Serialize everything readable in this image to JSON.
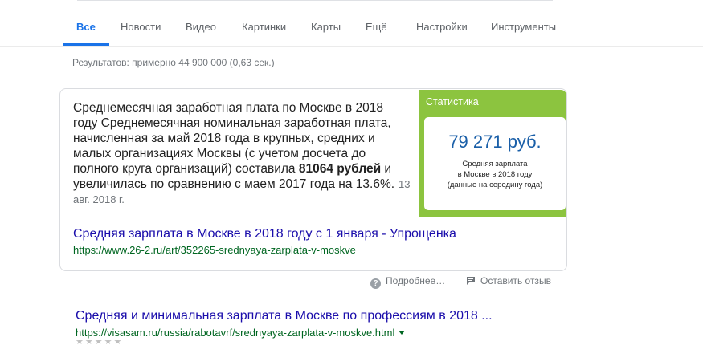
{
  "tabs": [
    {
      "label": "Все"
    },
    {
      "label": "Новости"
    },
    {
      "label": "Видео"
    },
    {
      "label": "Картинки"
    },
    {
      "label": "Карты"
    },
    {
      "label": "Ещё"
    },
    {
      "label": "Настройки"
    },
    {
      "label": "Инструменты"
    }
  ],
  "result_stats": "Результатов: примерно 44 900 000 (0,63 сек.)",
  "featured_snippet": {
    "text_before_bold": "Среднемесячная заработная плата по Москве в 2018 году Среднемесячная номинальная заработная плата, начисленная за май 2018 года в крупных, средних и малых организациях Москвы (с учетом досчета до полного круга организаций) составила ",
    "bold": "81064 рублей",
    "text_after_bold": " и увеличилась по сравнению с маем 2017 года на 13.6%.",
    "date": "13 авг. 2018 г.",
    "stat_panel": {
      "title": "Статистика",
      "value": "79 271 руб.",
      "desc_line1": "Средняя зарплата",
      "desc_line2": "в Москве в 2018 году",
      "desc_line3": "(данные на середину года)"
    },
    "title": "Средняя зарплата в Москве в 2018 году с 1 января - Упрощенка",
    "url": "https://www.26-2.ru/art/352265-srednyaya-zarplata-v-moskve"
  },
  "feedback": {
    "more_label": "Подробнее…",
    "feedback_label": "Оставить отзыв"
  },
  "result2": {
    "title": "Средняя и минимальная зарплата в Москве по профессиям в 2018 ...",
    "url": "https://visasam.ru/russia/rabotavrf/srednyaya-zarplata-v-moskve.html"
  },
  "colors": {
    "accent": "#1a73e8",
    "link": "#1a0dab",
    "url": "#006621",
    "stat_panel": "#8cc43f"
  }
}
